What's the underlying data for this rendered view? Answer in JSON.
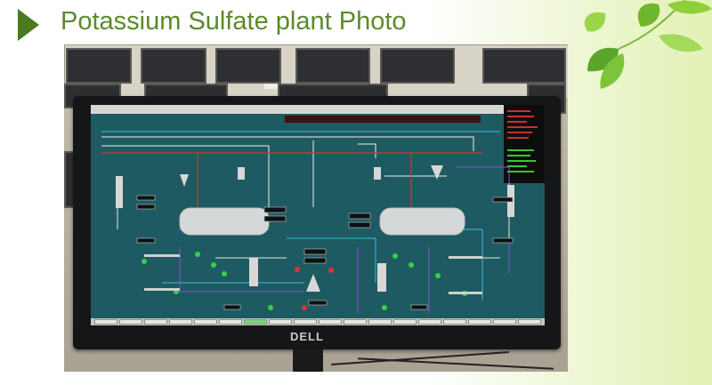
{
  "slide": {
    "title": "Potassium Sulfate plant Photo"
  },
  "monitor": {
    "brand": "DELL"
  },
  "colors": {
    "title": "#5b8a2a",
    "arrow": "#4a7a1c",
    "screen_bg": "#1e5a61"
  }
}
